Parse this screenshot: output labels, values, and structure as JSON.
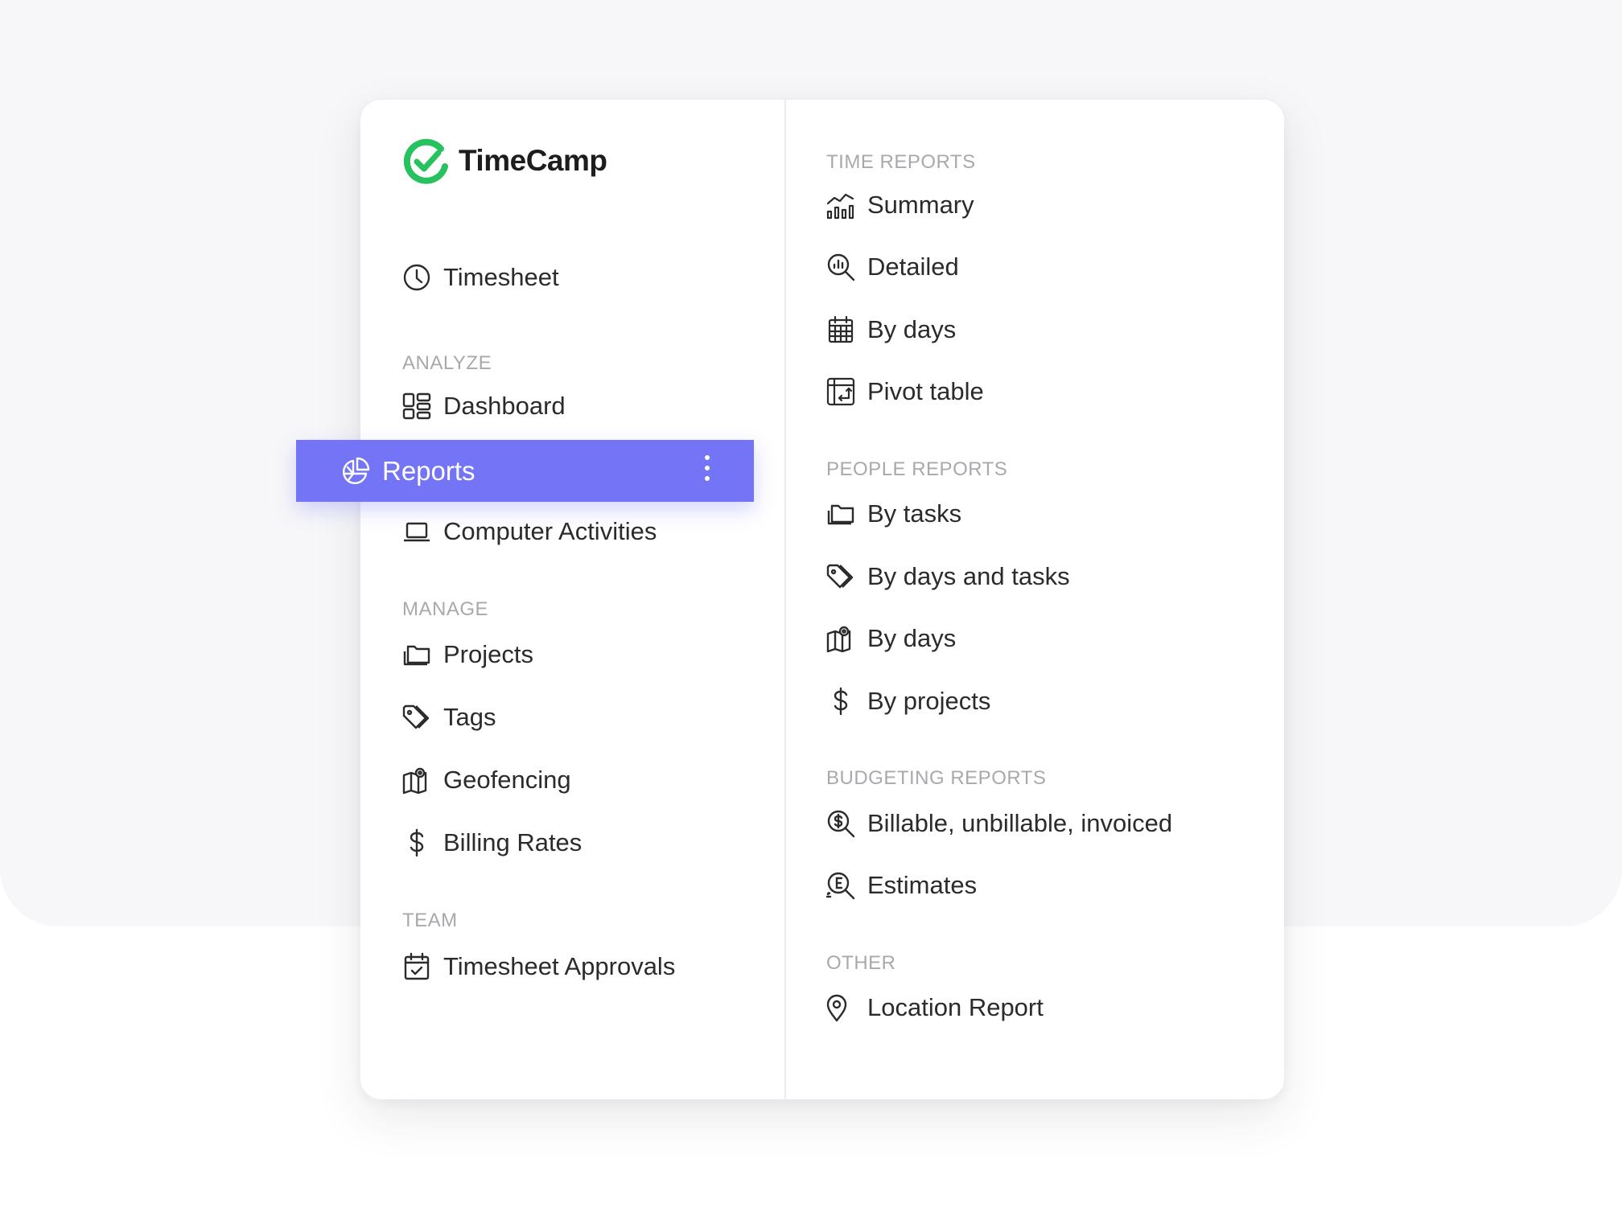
{
  "brand": {
    "name": "TimeCamp",
    "color": "#27c15f"
  },
  "accent_color": "#7474f7",
  "left_nav": {
    "top_items": [
      {
        "label": "Timesheet",
        "icon": "clock-icon"
      }
    ],
    "sections": [
      {
        "title": "ANALYZE",
        "items": [
          {
            "label": "Dashboard",
            "icon": "dashboard-icon"
          },
          {
            "label": "Reports",
            "icon": "pie-chart-icon",
            "active": true
          },
          {
            "label": "Computer Activities",
            "icon": "laptop-icon"
          }
        ]
      },
      {
        "title": "MANAGE",
        "items": [
          {
            "label": "Projects",
            "icon": "folder-icon"
          },
          {
            "label": "Tags",
            "icon": "tag-icon"
          },
          {
            "label": "Geofencing",
            "icon": "map-icon"
          },
          {
            "label": "Billing Rates",
            "icon": "dollar-icon"
          }
        ]
      },
      {
        "title": "TEAM",
        "items": [
          {
            "label": "Timesheet Approvals",
            "icon": "calendar-check-icon"
          }
        ]
      }
    ]
  },
  "submenu": {
    "sections": [
      {
        "title": "TIME REPORTS",
        "items": [
          {
            "label": "Summary",
            "icon": "bar-line-chart-icon"
          },
          {
            "label": "Detailed",
            "icon": "search-chart-icon"
          },
          {
            "label": "By days",
            "icon": "calendar-grid-icon"
          },
          {
            "label": "Pivot table",
            "icon": "pivot-table-icon"
          }
        ]
      },
      {
        "title": "PEOPLE REPORTS",
        "items": [
          {
            "label": "By tasks",
            "icon": "folder-icon"
          },
          {
            "label": "By days and tasks",
            "icon": "tag-icon"
          },
          {
            "label": "By days",
            "icon": "map-icon"
          },
          {
            "label": "By projects",
            "icon": "dollar-icon"
          }
        ]
      },
      {
        "title": "BUDGETING REPORTS",
        "items": [
          {
            "label": "Billable, unbillable, invoiced",
            "icon": "search-dollar-icon"
          },
          {
            "label": "Estimates",
            "icon": "search-euro-icon"
          }
        ]
      },
      {
        "title": "OTHER",
        "items": [
          {
            "label": "Location Report",
            "icon": "location-pin-icon"
          }
        ]
      }
    ]
  }
}
